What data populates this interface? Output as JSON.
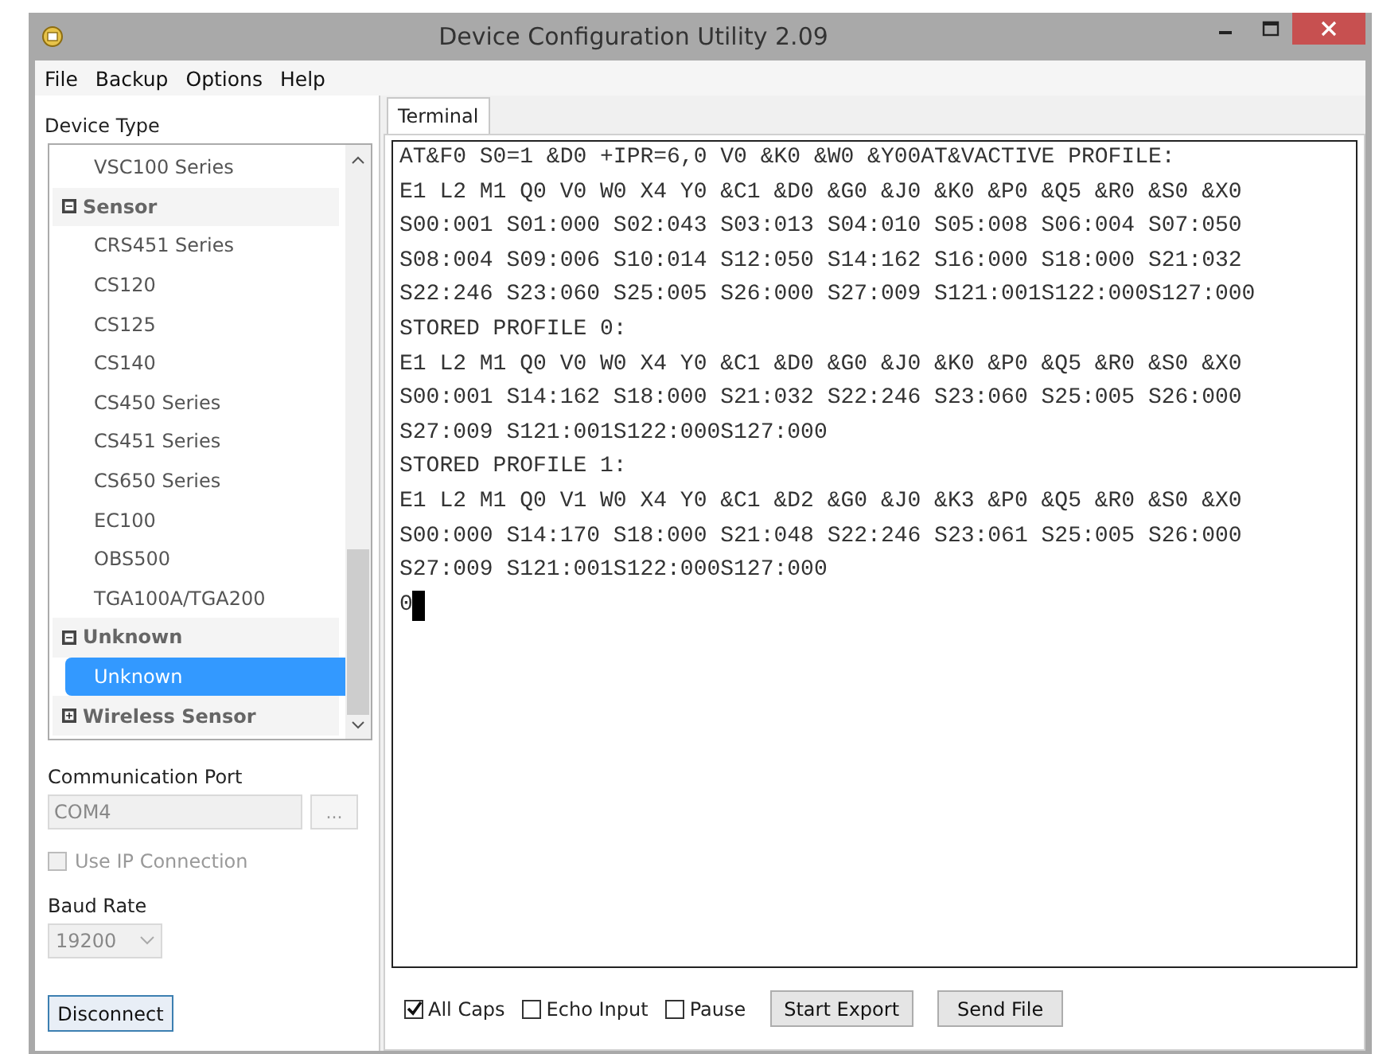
{
  "window": {
    "title": "Device Configuration Utility 2.09"
  },
  "menu": [
    "File",
    "Backup",
    "Options",
    "Help"
  ],
  "device_type": {
    "label": "Device Type",
    "items": [
      {
        "kind": "leaf",
        "label": "VSC100 Series",
        "selected": false
      },
      {
        "kind": "group",
        "label": "Sensor",
        "expanded": true,
        "children": [
          {
            "kind": "leaf",
            "label": "CRS451 Series",
            "selected": false
          },
          {
            "kind": "leaf",
            "label": "CS120",
            "selected": false
          },
          {
            "kind": "leaf",
            "label": "CS125",
            "selected": false
          },
          {
            "kind": "leaf",
            "label": "CS140",
            "selected": false
          },
          {
            "kind": "leaf",
            "label": "CS450 Series",
            "selected": false
          },
          {
            "kind": "leaf",
            "label": "CS451 Series",
            "selected": false
          },
          {
            "kind": "leaf",
            "label": "CS650 Series",
            "selected": false
          },
          {
            "kind": "leaf",
            "label": "EC100",
            "selected": false
          },
          {
            "kind": "leaf",
            "label": "OBS500",
            "selected": false
          },
          {
            "kind": "leaf",
            "label": "TGA100A/TGA200",
            "selected": false
          }
        ]
      },
      {
        "kind": "group",
        "label": "Unknown",
        "expanded": true,
        "children": [
          {
            "kind": "leaf",
            "label": "Unknown",
            "selected": true
          }
        ]
      },
      {
        "kind": "group",
        "label": "Wireless Sensor",
        "expanded": false
      }
    ]
  },
  "connection": {
    "port_label": "Communication Port",
    "port_value": "COM4",
    "browse_button": "...",
    "use_ip": {
      "label": "Use IP Connection",
      "checked": false,
      "disabled": true
    },
    "baud_label": "Baud Rate",
    "baud_value": "19200",
    "disconnect_button": "Disconnect"
  },
  "tabs": [
    {
      "label": "Terminal",
      "selected": true
    }
  ],
  "terminal": {
    "lines": [
      "AT&F0 S0=1 &D0 +IPR=6,0 V0 &K0 &W0 &Y00AT&VACTIVE PROFILE:",
      "E1 L2 M1 Q0 V0 W0 X4 Y0 &C1 &D0 &G0 &J0 &K0 &P0 &Q5 &R0 &S0 &X0",
      "S00:001 S01:000 S02:043 S03:013 S04:010 S05:008 S06:004 S07:050",
      "S08:004 S09:006 S10:014 S12:050 S14:162 S16:000 S18:000 S21:032",
      "S22:246 S23:060 S25:005 S26:000 S27:009 S121:001S122:000S127:000",
      "STORED PROFILE 0:",
      "E1 L2 M1 Q0 V0 W0 X4 Y0 &C1 &D0 &G0 &J0 &K0 &P0 &Q5 &R0 &S0 &X0",
      "S00:001 S14:162 S18:000 S21:032 S22:246 S23:060 S25:005 S26:000",
      "S27:009 S121:001S122:000S127:000",
      "STORED PROFILE 1:",
      "E1 L2 M1 Q0 V1 W0 X4 Y0 &C1 &D2 &G0 &J0 &K3 &P0 &Q5 &R0 &S0 &X0",
      "S00:000 S14:170 S18:000 S21:048 S22:246 S23:061 S25:005 S26:000",
      "S27:009 S121:001S122:000S127:000",
      "0"
    ]
  },
  "options": [
    {
      "label": "All Caps",
      "checked": true
    },
    {
      "label": "Echo Input",
      "checked": false
    },
    {
      "label": "Pause",
      "checked": false
    }
  ],
  "buttons": [
    "Start Export",
    "Send File"
  ]
}
